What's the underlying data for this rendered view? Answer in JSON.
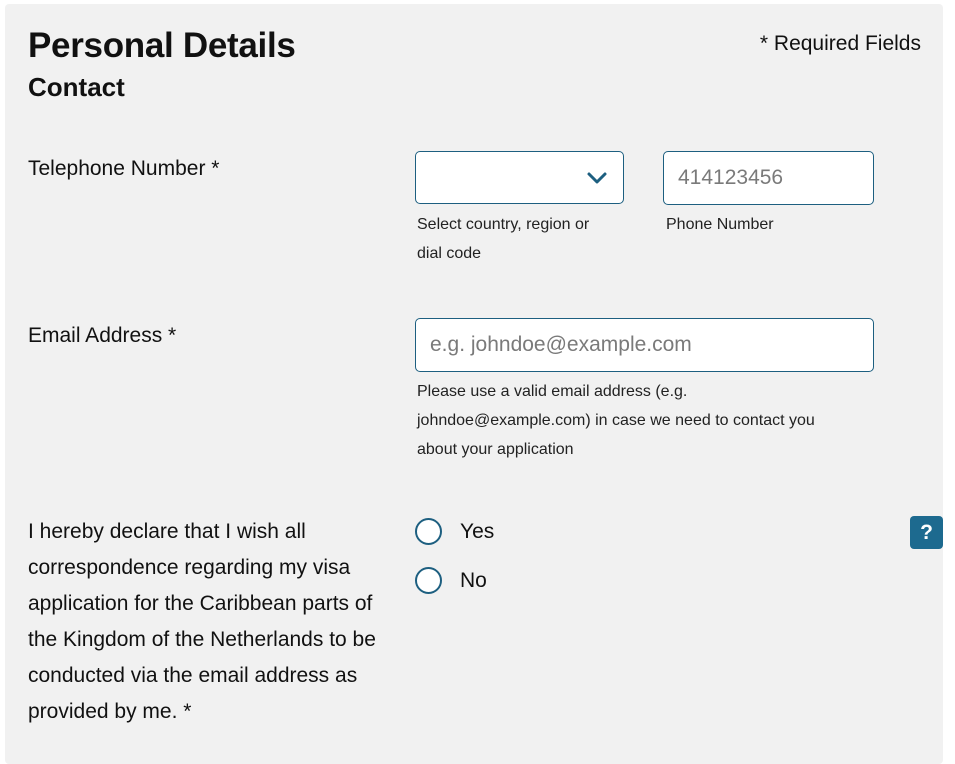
{
  "header": {
    "title": "Personal Details",
    "subtitle": "Contact",
    "required_note": "* Required Fields"
  },
  "telephone": {
    "label": "Telephone Number *",
    "country_select": {
      "selected_value": "",
      "help": "Select country, region or dial code",
      "icon": "chevron-down-icon"
    },
    "phone_input": {
      "value": "",
      "placeholder": "414123456",
      "help": "Phone Number"
    }
  },
  "email": {
    "label": "Email Address *",
    "value": "",
    "placeholder": "e.g. johndoe@example.com",
    "help": "Please use a valid email address (e.g. johndoe@example.com) in case we need to contact you about your application"
  },
  "declaration": {
    "text": "I hereby declare that I wish all correspondence regarding my visa application for the Caribbean parts of the Kingdom of the Netherlands to be conducted via the email address as provided by me. *",
    "options": [
      {
        "label": "Yes",
        "selected": false
      },
      {
        "label": "No",
        "selected": false
      }
    ],
    "help_button": "?"
  },
  "colors": {
    "accent": "#1d5f80",
    "help_button_bg": "#1d6a8f",
    "panel_bg": "#f1f1f1"
  }
}
